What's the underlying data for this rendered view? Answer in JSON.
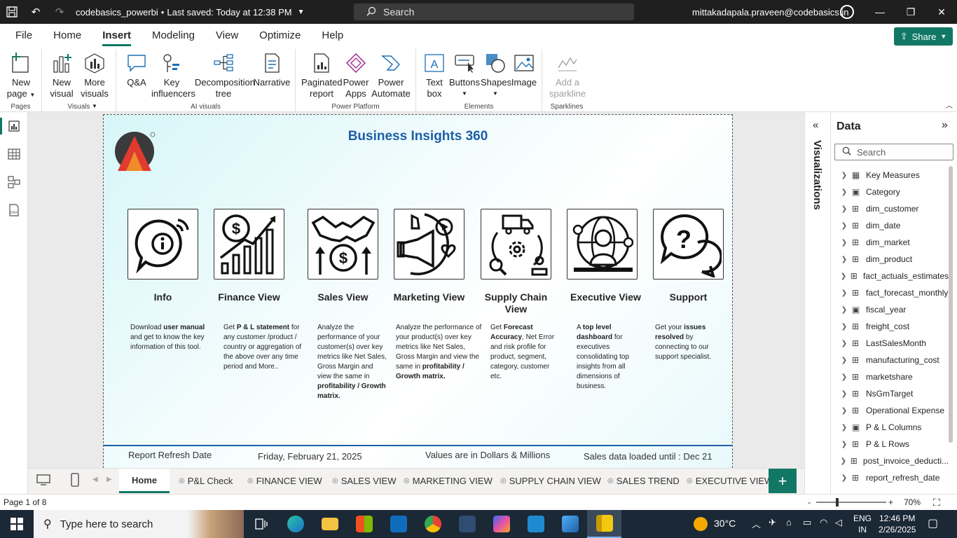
{
  "titlebar": {
    "file_name": "codebasics_powerbi",
    "saved_status": "Last saved: Today at 12:38 PM",
    "search_placeholder": "Search",
    "user_email": "mittakadapala.praveen@codebasics.in"
  },
  "menu": {
    "items": [
      "File",
      "Home",
      "Insert",
      "Modeling",
      "View",
      "Optimize",
      "Help"
    ],
    "active": "Insert",
    "share_label": "Share"
  },
  "ribbon": {
    "groups": {
      "pages": "Pages",
      "visuals": "Visuals",
      "ai_visuals": "AI visuals",
      "power_platform": "Power Platform",
      "elements": "Elements",
      "sparklines": "Sparklines"
    },
    "buttons": {
      "new_page": [
        "New",
        "page"
      ],
      "new_visual": [
        "New",
        "visual"
      ],
      "more_visuals": [
        "More",
        "visuals"
      ],
      "qa": "Q&A",
      "key_influencers": [
        "Key",
        "influencers"
      ],
      "decomposition_tree": [
        "Decomposition",
        "tree"
      ],
      "narrative": "Narrative",
      "paginated_report": [
        "Paginated",
        "report"
      ],
      "power_apps": [
        "Power",
        "Apps"
      ],
      "power_automate": [
        "Power",
        "Automate"
      ],
      "text_box": [
        "Text",
        "box"
      ],
      "buttons": "Buttons",
      "shapes": "Shapes",
      "image": "Image",
      "add_sparkline": [
        "Add a",
        "sparkline"
      ]
    }
  },
  "report": {
    "title": "Business Insights 360",
    "tiles": [
      {
        "title": "Info",
        "desc_html": "Download <b>user manual</b> and get to know the key information of this tool."
      },
      {
        "title": "Finance View",
        "desc_html": "Get <b>P &amp; L statement</b> for any customer /product / country or aggregation of the above over any time period and More.."
      },
      {
        "title": "Sales View",
        "desc_html": "Analyze the performance of your customer(s) over key metrics like Net Sales, Gross Margin and view the same in <b>profitability / Growth matrix.</b>"
      },
      {
        "title": "Marketing View",
        "desc_html": "Analyze the performance of your product(s) over key metrics like Net Sales, Gross Margin and view the same in <b>profitability / Growth matrix.</b>"
      },
      {
        "title": "Supply Chain View",
        "desc_html": "Get <b>Forecast Accuracy</b>, Net Error and risk profile for product, segment, category, customer etc."
      },
      {
        "title": "Executive View",
        "desc_html": "A <b>top level dashboard</b> for executives consolidating top insights from all dimensions of business."
      },
      {
        "title": "Support",
        "desc_html": "Get your <b>issues resolved</b> by connecting to our support specialist."
      }
    ],
    "footer": {
      "refresh_label": "Report Refresh Date",
      "refresh_date": "Friday, February 21, 2025",
      "units_note": "Values are in Dollars & Millions",
      "sales_loaded": "Sales data loaded until : Dec 21"
    }
  },
  "page_tabs": [
    "Home",
    "P&L Check",
    "FINANCE VIEW",
    "SALES VIEW",
    "MARKETING VIEW",
    "SUPPLY CHAIN VIEW",
    "SALES TREND",
    "EXECUTIVE VIEW"
  ],
  "panes": {
    "visualizations_label": "Visualizations",
    "data_title": "Data",
    "data_search_placeholder": "Search",
    "fields": [
      {
        "name": "Key Measures",
        "icon": "calc"
      },
      {
        "name": "Category",
        "icon": "calc-table"
      },
      {
        "name": "dim_customer",
        "icon": "table"
      },
      {
        "name": "dim_date",
        "icon": "table"
      },
      {
        "name": "dim_market",
        "icon": "table"
      },
      {
        "name": "dim_product",
        "icon": "table"
      },
      {
        "name": "fact_actuals_estimates",
        "icon": "table"
      },
      {
        "name": "fact_forecast_monthly",
        "icon": "table"
      },
      {
        "name": "fiscal_year",
        "icon": "calc-table"
      },
      {
        "name": "freight_cost",
        "icon": "table"
      },
      {
        "name": "LastSalesMonth",
        "icon": "table"
      },
      {
        "name": "manufacturing_cost",
        "icon": "table"
      },
      {
        "name": "marketshare",
        "icon": "table"
      },
      {
        "name": "NsGmTarget",
        "icon": "table"
      },
      {
        "name": "Operational Expense",
        "icon": "table"
      },
      {
        "name": "P & L Columns",
        "icon": "calc-table"
      },
      {
        "name": "P & L Rows",
        "icon": "table"
      },
      {
        "name": "post_invoice_deducti...",
        "icon": "table"
      },
      {
        "name": "report_refresh_date",
        "icon": "table"
      }
    ]
  },
  "status": {
    "page_indicator": "Page 1 of 8",
    "zoom": "70%"
  },
  "taskbar": {
    "search_placeholder": "Type here to search",
    "weather": "30°C",
    "lang": "ENG",
    "region": "IN",
    "time": "12:46 PM",
    "date": "2/26/2025"
  },
  "colors": {
    "accent": "#117865",
    "title_blue": "#1d5fa5",
    "titlebar": "#1f1f1f",
    "taskbar": "#1b2836"
  }
}
